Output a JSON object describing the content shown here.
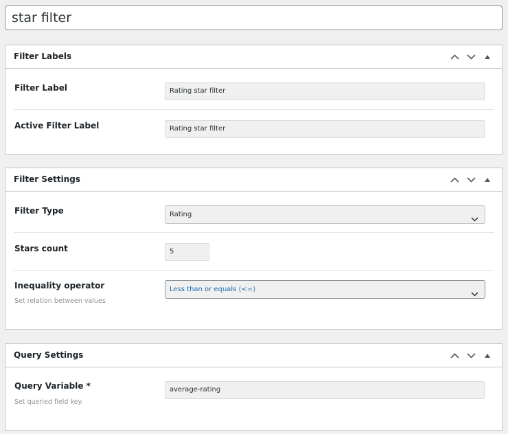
{
  "post_title": "star filter",
  "boxes": {
    "filter_labels": {
      "title": "Filter Labels",
      "fields": {
        "filter_label": {
          "label": "Filter Label",
          "value": "Rating star filter"
        },
        "active_filter_label": {
          "label": "Active Filter Label",
          "value": "Rating star filter"
        }
      }
    },
    "filter_settings": {
      "title": "Filter Settings",
      "fields": {
        "filter_type": {
          "label": "Filter Type",
          "value": "Rating"
        },
        "stars_count": {
          "label": "Stars count",
          "value": "5"
        },
        "inequality_operator": {
          "label": "Inequality operator",
          "description": "Set relation between values",
          "value": "Less than or equals (<=)"
        }
      }
    },
    "query_settings": {
      "title": "Query Settings",
      "fields": {
        "query_variable": {
          "label": "Query Variable *",
          "description": "Set queried field key.",
          "value": "average-rating"
        }
      }
    }
  },
  "icons": {
    "move_up": "chevron-up-icon",
    "move_down": "chevron-down-icon",
    "toggle": "triangle-up-icon",
    "select_caret": "chevron-down-icon"
  },
  "colors": {
    "background": "#f0f0f1",
    "border": "#c3c4c7",
    "text": "#1d2327",
    "muted": "#8c8f94",
    "link": "#2271b1"
  }
}
